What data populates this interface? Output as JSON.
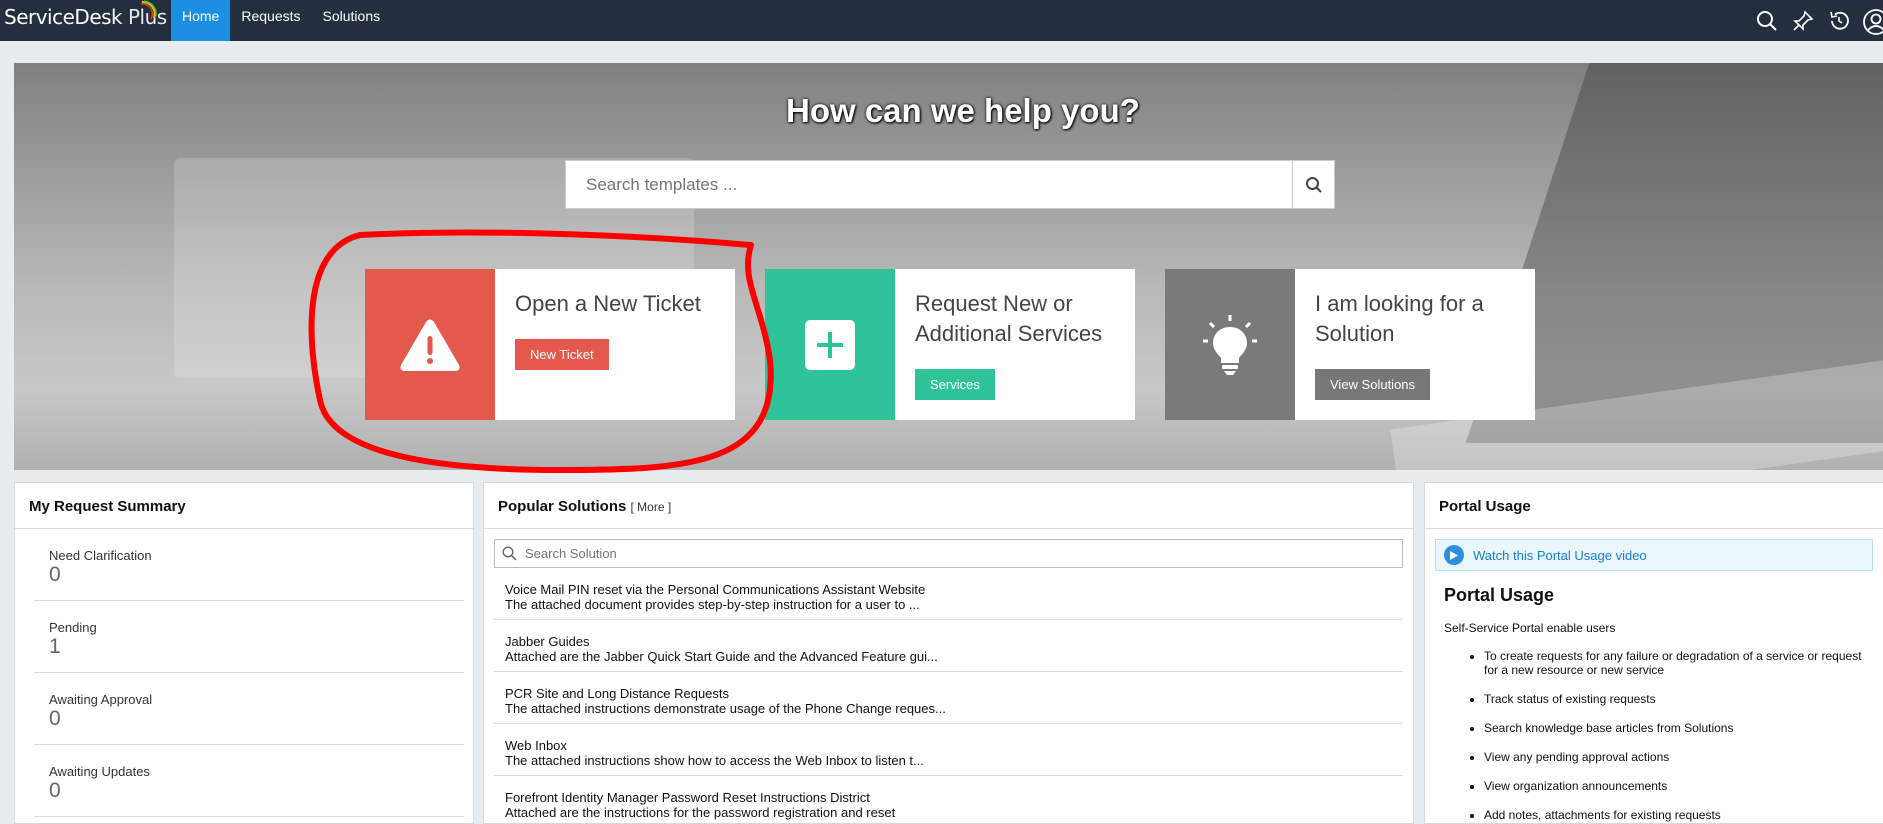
{
  "topbar": {
    "logo_text": "ServiceDesk",
    "logo_plus": " Plus",
    "nav": [
      {
        "label": "Home",
        "active": true
      },
      {
        "label": "Requests"
      },
      {
        "label": "Solutions"
      }
    ],
    "icons": [
      "search-icon",
      "pin-icon",
      "history-icon",
      "user-icon"
    ]
  },
  "hero": {
    "title": "How can we help you?",
    "search_placeholder": "Search templates ..."
  },
  "cards": [
    {
      "title": "Open a New Ticket",
      "button": "New Ticket",
      "icon": "warning-icon",
      "color": "#e35a4c"
    },
    {
      "title_line1": "Request New or",
      "title_line2": "Additional Services",
      "button": "Services",
      "icon": "plus-icon",
      "color": "#2fc39a"
    },
    {
      "title_line1": "I am looking for a",
      "title_line2": "Solution",
      "button": "View Solutions",
      "icon": "lightbulb-icon",
      "color": "#7a7a7a"
    }
  ],
  "request_summary": {
    "title": "My Request Summary",
    "items": [
      {
        "label": "Need Clarification",
        "value": "0"
      },
      {
        "label": "Pending",
        "value": "1"
      },
      {
        "label": "Awaiting Approval",
        "value": "0"
      },
      {
        "label": "Awaiting Updates",
        "value": "0"
      }
    ]
  },
  "popular_solutions": {
    "title": "Popular Solutions",
    "more": "[ More ]",
    "search_placeholder": "Search Solution",
    "items": [
      {
        "title": "Voice Mail PIN reset via the Personal Communications Assistant Website",
        "desc": "The attached document provides step-by-step instruction for a user to ..."
      },
      {
        "title": "Jabber Guides",
        "desc": "Attached are the Jabber Quick Start Guide and the Advanced Feature gui..."
      },
      {
        "title": "PCR Site and Long Distance Requests",
        "desc": "The attached instructions demonstrate usage of the Phone Change reques..."
      },
      {
        "title": "Web Inbox",
        "desc": "The attached instructions show how to access the Web Inbox to listen t..."
      },
      {
        "title": "Forefront Identity Manager Password Reset Instructions District",
        "desc": "Attached are the instructions for the password registration and reset"
      }
    ]
  },
  "portal_usage": {
    "title": "Portal Usage",
    "video_link": "Watch this Portal Usage video",
    "heading": "Portal Usage",
    "subtitle": "Self-Service Portal enable users",
    "bullets": [
      "To create requests for any failure or degradation of a service or request for a new resource or new service",
      "Track status of existing requests",
      "Search knowledge base articles from Solutions",
      "View any pending approval actions",
      "View organization announcements",
      "Add notes, attachments for existing requests"
    ]
  },
  "colors": {
    "topbar": "#232f3e",
    "nav_active": "#1a8fe3",
    "annotation": "#ff0000"
  }
}
